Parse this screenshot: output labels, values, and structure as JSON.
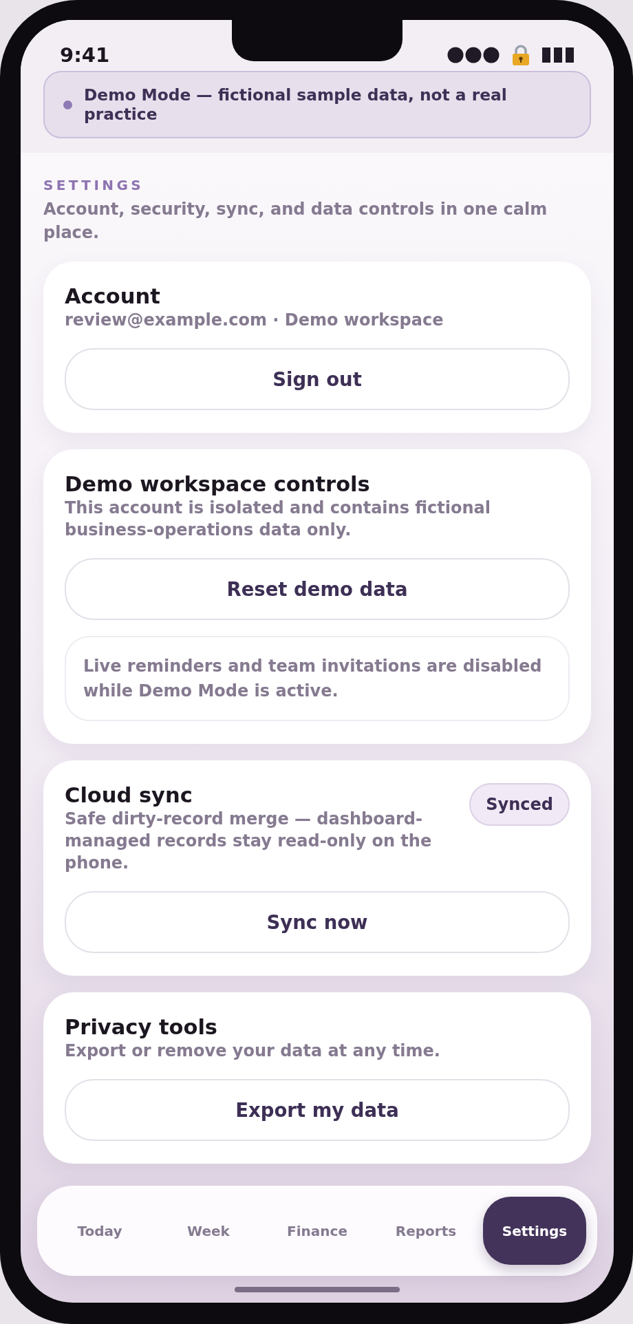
{
  "status_bar": {
    "time": "9:41"
  },
  "banner": {
    "text": "Demo Mode — fictional sample data, not a real practice"
  },
  "header": {
    "eyebrow": "SETTINGS",
    "subtitle": "Account, security, sync, and data controls in one calm place."
  },
  "cards": [
    {
      "title": "Account",
      "description": "review@example.com · Demo workspace",
      "button": "Sign out"
    },
    {
      "title": "Demo workspace controls",
      "description": "This account is isolated and contains fictional business-operations data only.",
      "button": "Reset demo data",
      "note": "Live reminders and team invitations are disabled while Demo Mode is active."
    },
    {
      "title": "Cloud sync",
      "badge": "Synced",
      "description": "Safe dirty-record merge — dashboard-managed records stay read-only on the phone.",
      "button": "Sync now"
    },
    {
      "title": "Privacy tools",
      "description": "Export or remove your data at any time.",
      "button": "Export my data"
    }
  ],
  "tab_bar": {
    "tabs": [
      {
        "label": "Today",
        "selected": false
      },
      {
        "label": "Week",
        "selected": false
      },
      {
        "label": "Finance",
        "selected": false
      },
      {
        "label": "Reports",
        "selected": false
      },
      {
        "label": "Settings",
        "selected": true
      }
    ]
  }
}
